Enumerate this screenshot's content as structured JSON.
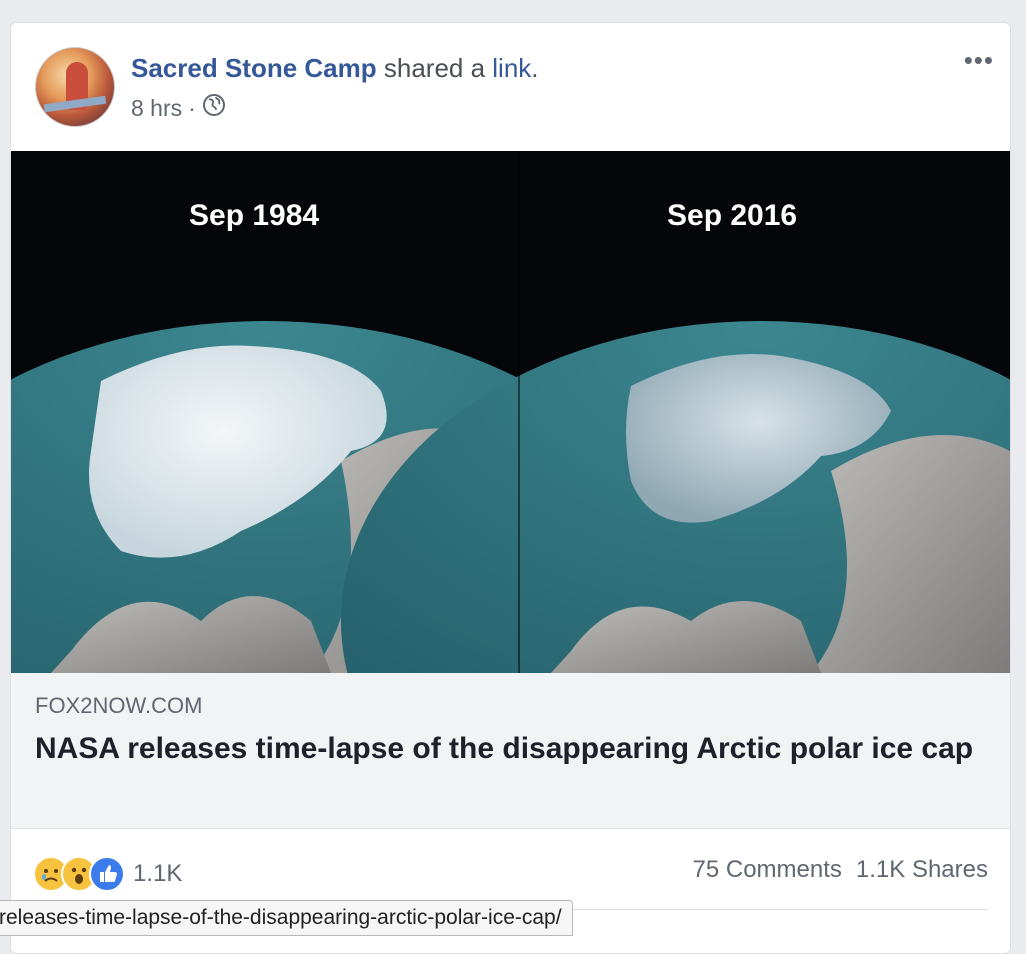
{
  "post": {
    "author": "Sacred Stone Camp",
    "action_text": " shared a ",
    "action_link": "link",
    "action_suffix": ".",
    "time": "8 hrs",
    "separator": "·",
    "privacy_icon": "globe-icon",
    "more_label": "•••"
  },
  "media": {
    "left_label": "Sep 1984",
    "right_label": "Sep 2016"
  },
  "link": {
    "domain": "FOX2NOW.COM",
    "title": "NASA releases time-lapse of the disappearing Arctic polar ice cap"
  },
  "stats": {
    "reactions": [
      "sad-reaction-icon",
      "wow-reaction-icon",
      "like-reaction-icon"
    ],
    "reaction_count": "1.1K",
    "comments": "75 Comments",
    "shares": "1.1K Shares"
  },
  "status_bar": {
    "url": "releases-time-lapse-of-the-disappearing-arctic-polar-ice-cap/"
  },
  "colors": {
    "link_blue": "#365899",
    "background": "#e9ebee",
    "like_blue": "#3b7bea",
    "reaction_yellow": "#f7c23d",
    "ocean": "#2f6f7a"
  }
}
